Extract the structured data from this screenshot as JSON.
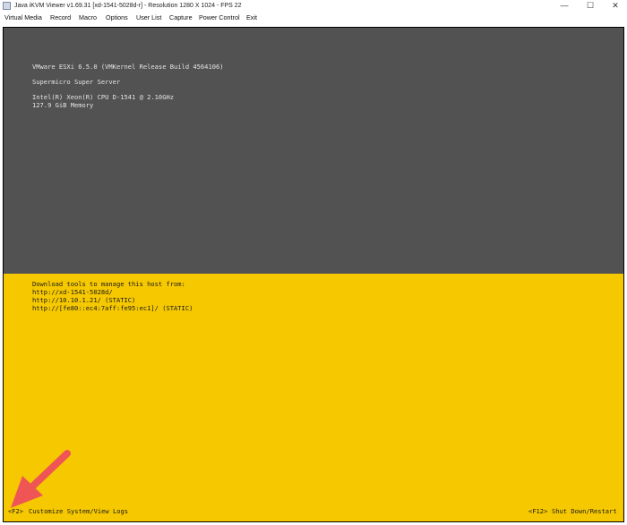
{
  "window": {
    "title": "Java iKVM Viewer v1.69.31 [xd-1541-5028d-r] - Resolution 1280 X 1024 - FPS 22",
    "controls": {
      "minimize": "—",
      "maximize": "☐",
      "close": "✕"
    }
  },
  "menu": [
    "Virtual Media",
    "Record",
    "Macro",
    "Options",
    "User List",
    "Capture",
    "Power Control",
    "Exit"
  ],
  "console": {
    "info": {
      "version": "VMware ESXi 6.5.0 (VMKernel Release Build 4564106)",
      "vendor": "Supermicro Super Server",
      "cpu": "Intel(R) Xeon(R) CPU D-1541 @ 2.10GHz",
      "memory": "127.9 GiB Memory"
    },
    "download": {
      "heading": "Download tools to manage this host from:",
      "urls": [
        "http://xd-1541-5028d/",
        "http://10.10.1.21/ (STATIC)",
        "http://[fe80::ec4:7aff:fe95:ec1]/ (STATIC)"
      ]
    },
    "footer": {
      "left_key": "<F2>",
      "left_label": "Customize System/View Logs",
      "right_key": "<F12>",
      "right_label": "Shut Down/Restart"
    }
  },
  "colors": {
    "console_top": "#525252",
    "console_bottom": "#f6c800",
    "annotation_arrow": "#f05555"
  }
}
